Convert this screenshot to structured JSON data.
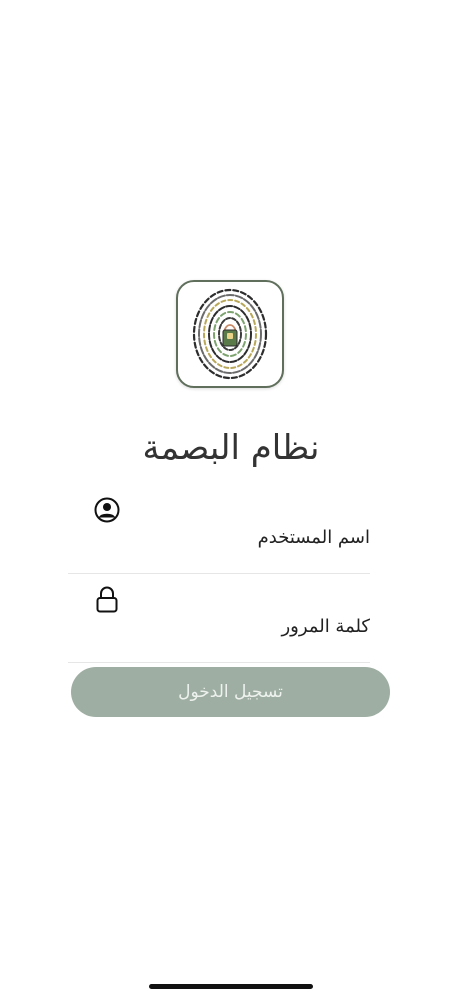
{
  "app": {
    "title": "نظام البصمة",
    "logo_icon": "fingerprint-logo-icon"
  },
  "form": {
    "username": {
      "placeholder": "اسم المستخدم",
      "icon": "user-circle-icon"
    },
    "password": {
      "placeholder": "كلمة المرور",
      "icon": "lock-icon"
    },
    "login_label": "تسجيل الدخول"
  },
  "colors": {
    "button_bg": "#9eaea3",
    "button_text": "#eef2ee",
    "logo_border": "#5f6f5c",
    "divider": "#e6e6e6"
  }
}
